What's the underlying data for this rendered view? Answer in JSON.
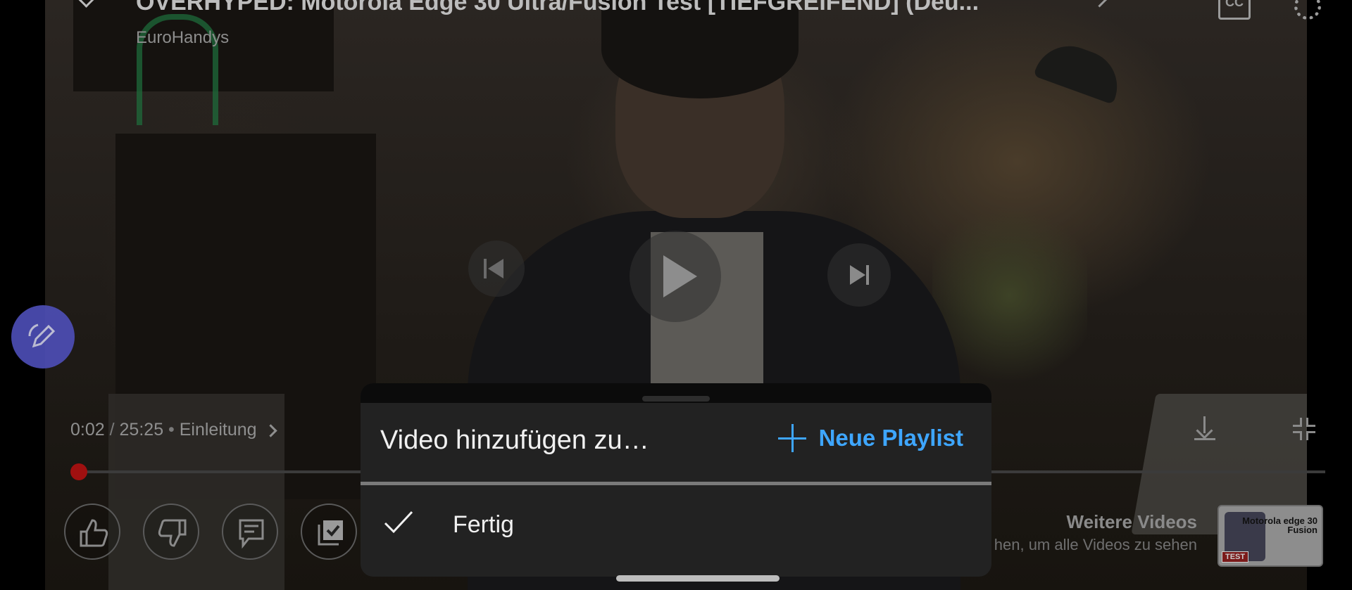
{
  "video": {
    "title": "OVERHYPED: Motorola Edge 30 Ultra/Fusion Test [TIEFGREIFEND] (Deu...",
    "channel": "EuroHandys",
    "current_time": "0:02",
    "duration": "25:25",
    "chapter": "Einleitung",
    "progress_fraction": 0.0013
  },
  "overlay": {
    "cc_label": "CC",
    "more_videos_title": "Weitere Videos",
    "more_videos_subtitle": "hen, um alle Videos zu sehen"
  },
  "thumbnail": {
    "text": "Motorola edge 30 Fusion",
    "badge": "TEST"
  },
  "sheet": {
    "title": "Video hinzufügen zu…",
    "new_playlist_label": "Neue Playlist",
    "done_label": "Fertig"
  },
  "colors": {
    "accent": "#3ea6ff",
    "progress": "#b81d1d",
    "sheet_bg": "#222222",
    "fab": "#4e4fb8"
  },
  "icons": {
    "top_left": "chevron-down-icon",
    "captions": "cc-icon",
    "settings": "gear-icon",
    "previous": "skip-previous-icon",
    "play": "play-icon",
    "next": "skip-next-icon",
    "download": "download-icon",
    "exit_fullscreen": "exit-fullscreen-icon",
    "like": "thumbs-up-icon",
    "dislike": "thumbs-down-icon",
    "comments": "comment-icon",
    "save": "save-playlist-icon",
    "edit": "edit-pen-icon",
    "add": "plus-icon",
    "done": "checkmark-icon"
  }
}
